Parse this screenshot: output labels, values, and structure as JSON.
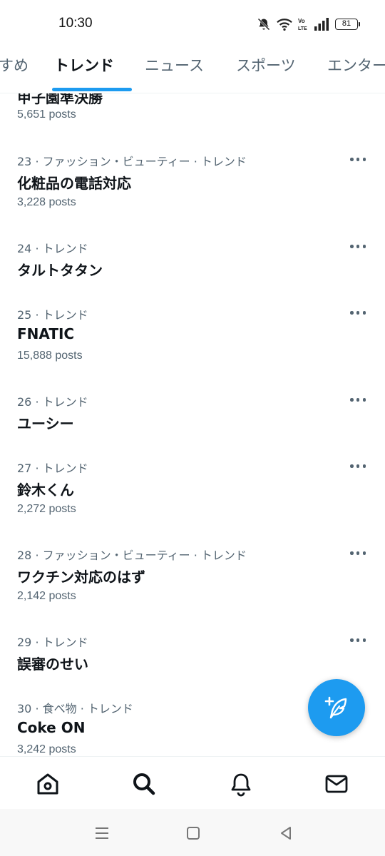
{
  "status_bar": {
    "time": "10:30",
    "battery": "81"
  },
  "tabs": {
    "items": [
      {
        "label": "すめ"
      },
      {
        "label": "トレンド"
      },
      {
        "label": "ニュース"
      },
      {
        "label": "スポーツ"
      },
      {
        "label": "エンター"
      }
    ],
    "active_index": 1
  },
  "partial_trend": {
    "title": "甲子園準決勝",
    "count": "5,651 posts"
  },
  "trends": [
    {
      "meta": "23 · ファッション・ビューティー · トレンド",
      "title": "化粧品の電話対応",
      "count": "3,228 posts"
    },
    {
      "meta": "24 · トレンド",
      "title": "タルトタタン",
      "count": ""
    },
    {
      "meta": "25 · トレンド",
      "title": "FNATIC",
      "count": "15,888 posts"
    },
    {
      "meta": "26 · トレンド",
      "title": "ユーシー",
      "count": ""
    },
    {
      "meta": "27 · トレンド",
      "title": "鈴木くん",
      "count": "2,272 posts"
    },
    {
      "meta": "28 · ファッション・ビューティー · トレンド",
      "title": "ワクチン対応のはず",
      "count": "2,142 posts"
    },
    {
      "meta": "29 · トレンド",
      "title": "誤審のせい",
      "count": ""
    },
    {
      "meta": "30 · 食べ物 · トレンド",
      "title": "Coke ON",
      "count": "3,242 posts"
    }
  ],
  "icons": {
    "mute": "bell-off-icon",
    "wifi": "wifi-icon",
    "volte": "volte-icon",
    "signal": "signal-icon",
    "more": "more-icon",
    "fab": "compose-post-icon",
    "home": "home-icon",
    "search": "search-icon",
    "notifications": "bell-icon",
    "messages": "mail-icon",
    "recents": "menu-icon",
    "home_sys": "square-icon",
    "back": "back-triangle-icon"
  },
  "colors": {
    "accent": "#1d9bf0",
    "text_primary": "#0f1419",
    "text_secondary": "#536471"
  }
}
